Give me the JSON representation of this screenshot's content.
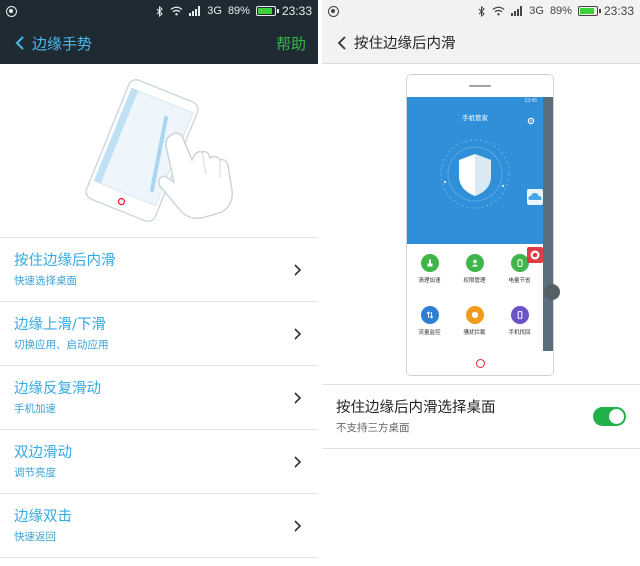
{
  "status_left": {
    "battery": "89%",
    "time": "23:33",
    "network": "3G",
    "battery_level": 0.89
  },
  "status_right": {
    "battery": "89%",
    "time": "23:33",
    "network": "3G",
    "battery_level": 0.89
  },
  "left": {
    "title": "边缘手势",
    "help_label": "帮助",
    "items": [
      {
        "title": "按住边缘后内滑",
        "subtitle": "快速选择桌面"
      },
      {
        "title": "边缘上滑/下滑",
        "subtitle": "切换应用、启动应用"
      },
      {
        "title": "边缘反复滑动",
        "subtitle": "手机加速"
      },
      {
        "title": "双边滑动",
        "subtitle": "调节亮度"
      },
      {
        "title": "边缘双击",
        "subtitle": "快速返回"
      }
    ]
  },
  "right": {
    "title": "按住边缘后内滑",
    "preview": {
      "app_title": "手机管家",
      "time": "13:45",
      "apps": [
        {
          "label": "清理加速",
          "icon": "broom-icon",
          "color": "#3fb54a"
        },
        {
          "label": "权限管理",
          "icon": "shield-person-icon",
          "color": "#3fb54a"
        },
        {
          "label": "电量节省",
          "icon": "battery-icon",
          "color": "#3fb54a"
        },
        {
          "label": "流量监控",
          "icon": "traffic-icon",
          "color": "#2d7fd6"
        },
        {
          "label": "骚扰拦截",
          "icon": "block-icon",
          "color": "#f29a1c"
        },
        {
          "label": "手机找回",
          "icon": "phone-find-icon",
          "color": "#6b54c8"
        }
      ]
    },
    "setting": {
      "title": "按住边缘后内滑选择桌面",
      "subtitle": "不支持三方桌面",
      "enabled": true
    }
  },
  "colors": {
    "accent_blue": "#35a9e1",
    "toggle_on": "#22b04a",
    "help_green": "#36b44a",
    "dark_bar": "#1f2b32"
  }
}
